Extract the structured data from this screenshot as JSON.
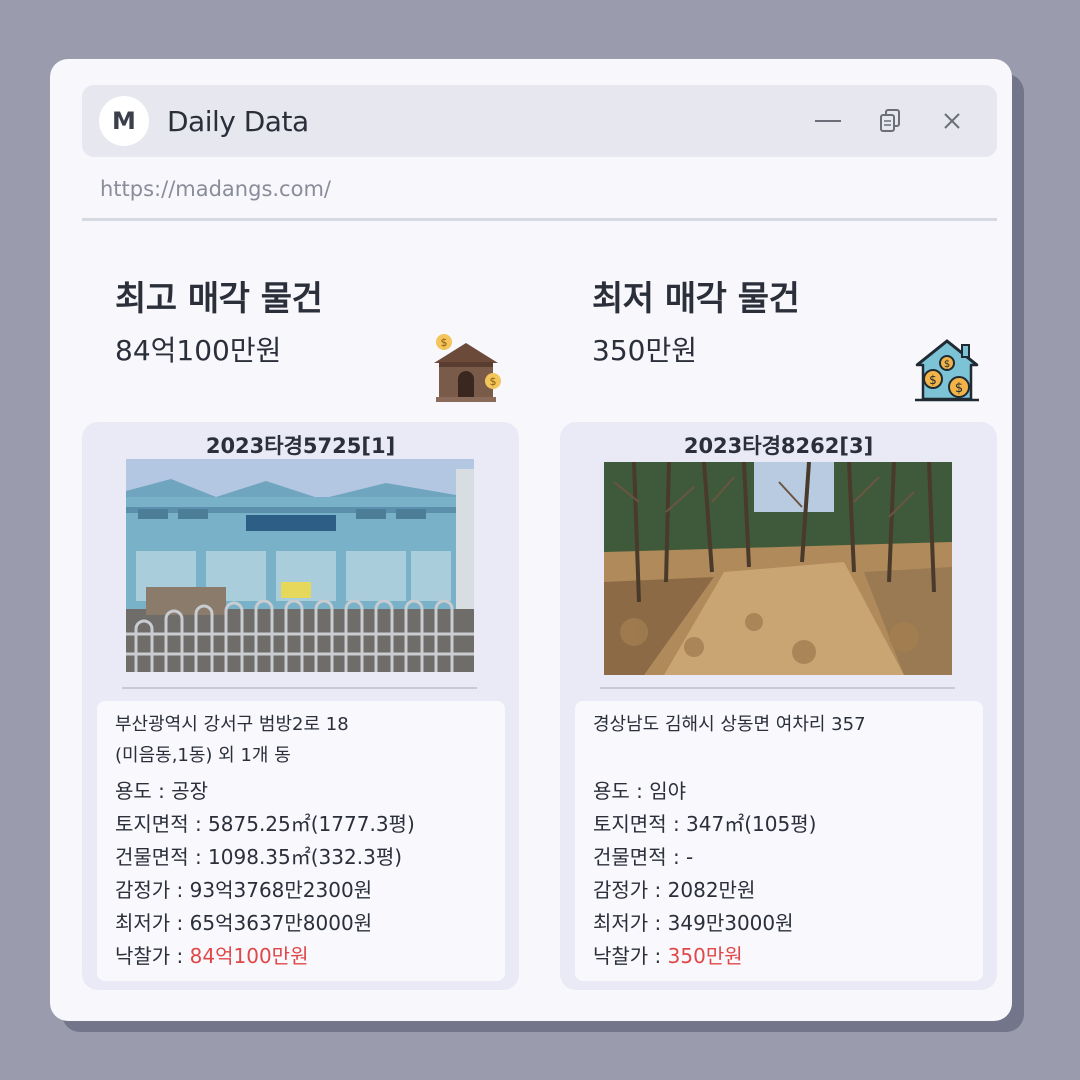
{
  "app": {
    "logo_letter": "M",
    "title": "Daily Data",
    "url": "https://madangs.com/",
    "controls": [
      "minimize-icon",
      "copy-icon",
      "close-icon"
    ]
  },
  "highest": {
    "heading": "최고 매각 물건",
    "price": "84억100만원",
    "icon": "house-money-icon",
    "case_no": "2023타경5725[1]",
    "photo": "factory-building-photo",
    "address_line1": "부산광역시 강서구 범방2로 18",
    "address_line2": "(미음동,1동) 외 1개 동",
    "usage": "용도 : 공장",
    "land_area": "토지면적 : 5875.25㎡(1777.3평)",
    "building_area": "건물면적 : 1098.35㎡(332.3평)",
    "appraised": "감정가 : 93억3768만2300원",
    "minimum": "최저가 : 65억3637만8000원",
    "winning_label": "낙찰가 : ",
    "winning_value": "84억100만원"
  },
  "lowest": {
    "heading": "최저 매각 물건",
    "price": "350만원",
    "icon": "house-coins-icon",
    "case_no": "2023타경8262[3]",
    "photo": "forest-land-photo",
    "address_line1": "경상남도 김해시 상동면 여차리 357",
    "address_line2": "",
    "usage": "용도 : 임야",
    "land_area": "토지면적 : 347㎡(105평)",
    "building_area": "건물면적 : -",
    "appraised": "감정가 : 2082만원",
    "minimum": "최저가 : 349만3000원",
    "winning_label": "낙찰가 : ",
    "winning_value": "350만원"
  },
  "colors": {
    "background": "#9a9cad",
    "window": "#f7f7fc",
    "card": "#e9eaf6",
    "accent_red": "#e04848"
  }
}
